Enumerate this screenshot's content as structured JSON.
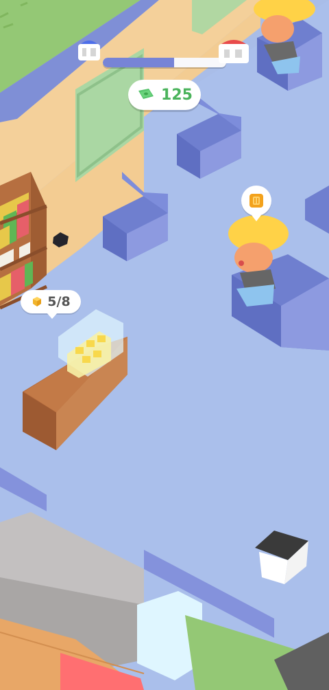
{
  "hud": {
    "level_progress": 0.58,
    "money_value": "125",
    "progress_start_icon": "house-icon",
    "progress_end_icon": "house-icon"
  },
  "stock": {
    "label": "5/8",
    "icon": "cube-icon"
  },
  "customer_request": {
    "icon": "ticket-icon"
  },
  "colors": {
    "floor": "#a9bde8",
    "wall": "#f4cf96",
    "grass": "#93c96f",
    "sofa": "#6f7fcf",
    "counter": "#b56b3d",
    "money_green": "#4ab35b",
    "progress_fill": "#7784d6"
  }
}
